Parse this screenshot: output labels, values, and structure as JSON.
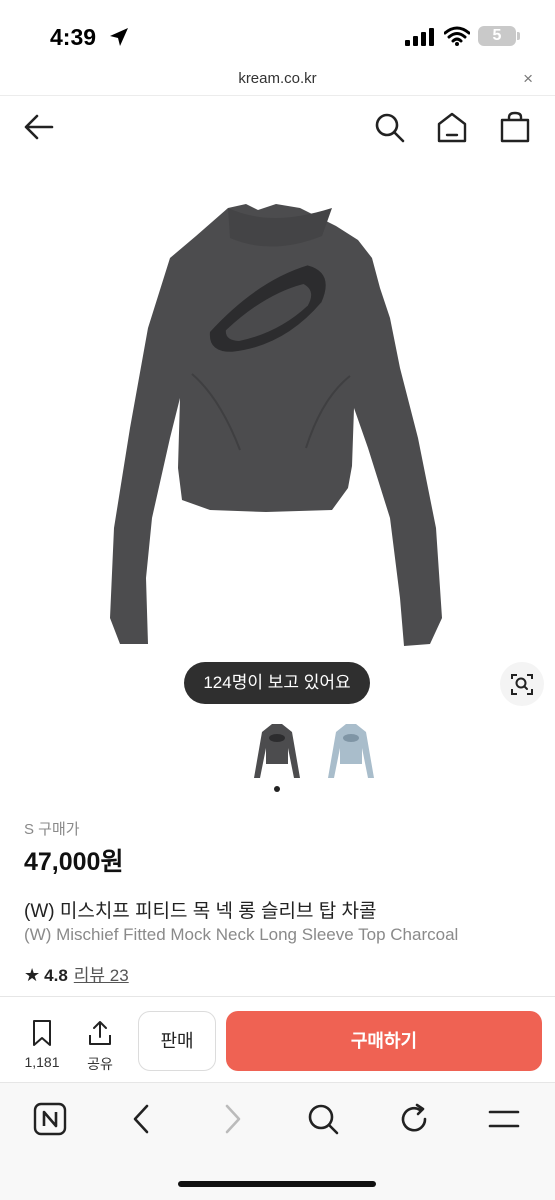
{
  "status_bar": {
    "time": "4:39",
    "battery": "5"
  },
  "url_bar": {
    "url": "kream.co.kr",
    "close": "×"
  },
  "product": {
    "viewers_pill": "124명이 보고 있어요",
    "size_label": "S 구매가",
    "price": "47,000원",
    "title_ko": "(W) 미스치프 피티드 목 넥 롱 슬리브 탑 차콜",
    "title_en": "(W) Mischief Fitted Mock Neck Long Sleeve Top Charcoal",
    "rating": "4.8",
    "review_label": "리뷰 23",
    "star": "★"
  },
  "actions": {
    "bookmark_count": "1,181",
    "share_label": "공유",
    "sell_label": "판매",
    "buy_label": "구매하기"
  },
  "colors": {
    "accent": "#ef6253",
    "shirt_primary": "#4c4c4e",
    "shirt_alt": "#a9bdcb"
  }
}
